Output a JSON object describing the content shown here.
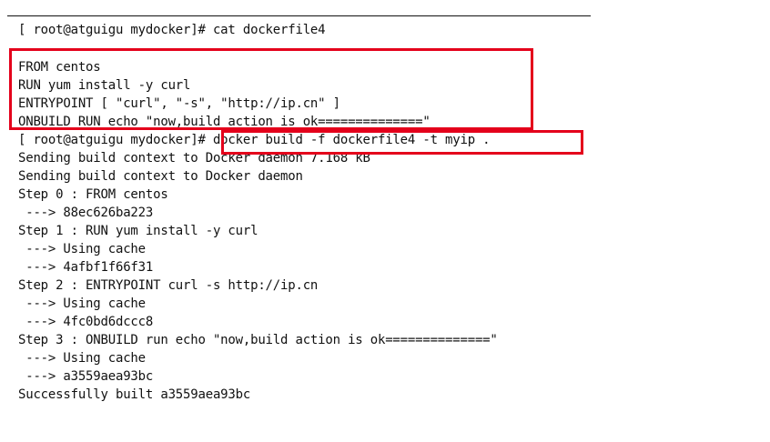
{
  "terminal": {
    "lines": [
      "[ root@atguigu mydocker]# cat dockerfile4",
      "",
      "FROM centos",
      "RUN yum install -y curl",
      "ENTRYPOINT [ \"curl\", \"-s\", \"http://ip.cn\" ]",
      "ONBUILD RUN echo \"now,build action is ok==============\"",
      "[ root@atguigu mydocker]# docker build -f dockerfile4 -t myip .",
      "Sending build context to Docker daemon 7.168 kB",
      "Sending build context to Docker daemon",
      "Step 0 : FROM centos",
      " ---> 88ec626ba223",
      "Step 1 : RUN yum install -y curl",
      " ---> Using cache",
      " ---> 4afbf1f66f31",
      "Step 2 : ENTRYPOINT curl -s http://ip.cn",
      " ---> Using cache",
      " ---> 4fc0bd6dccc8",
      "Step 3 : ONBUILD run echo \"now,build action is ok==============\"",
      " ---> Using cache",
      " ---> a3559aea93bc",
      "Successfully built a3559aea93bc"
    ]
  },
  "highlights": {
    "color": "#e4001b"
  }
}
